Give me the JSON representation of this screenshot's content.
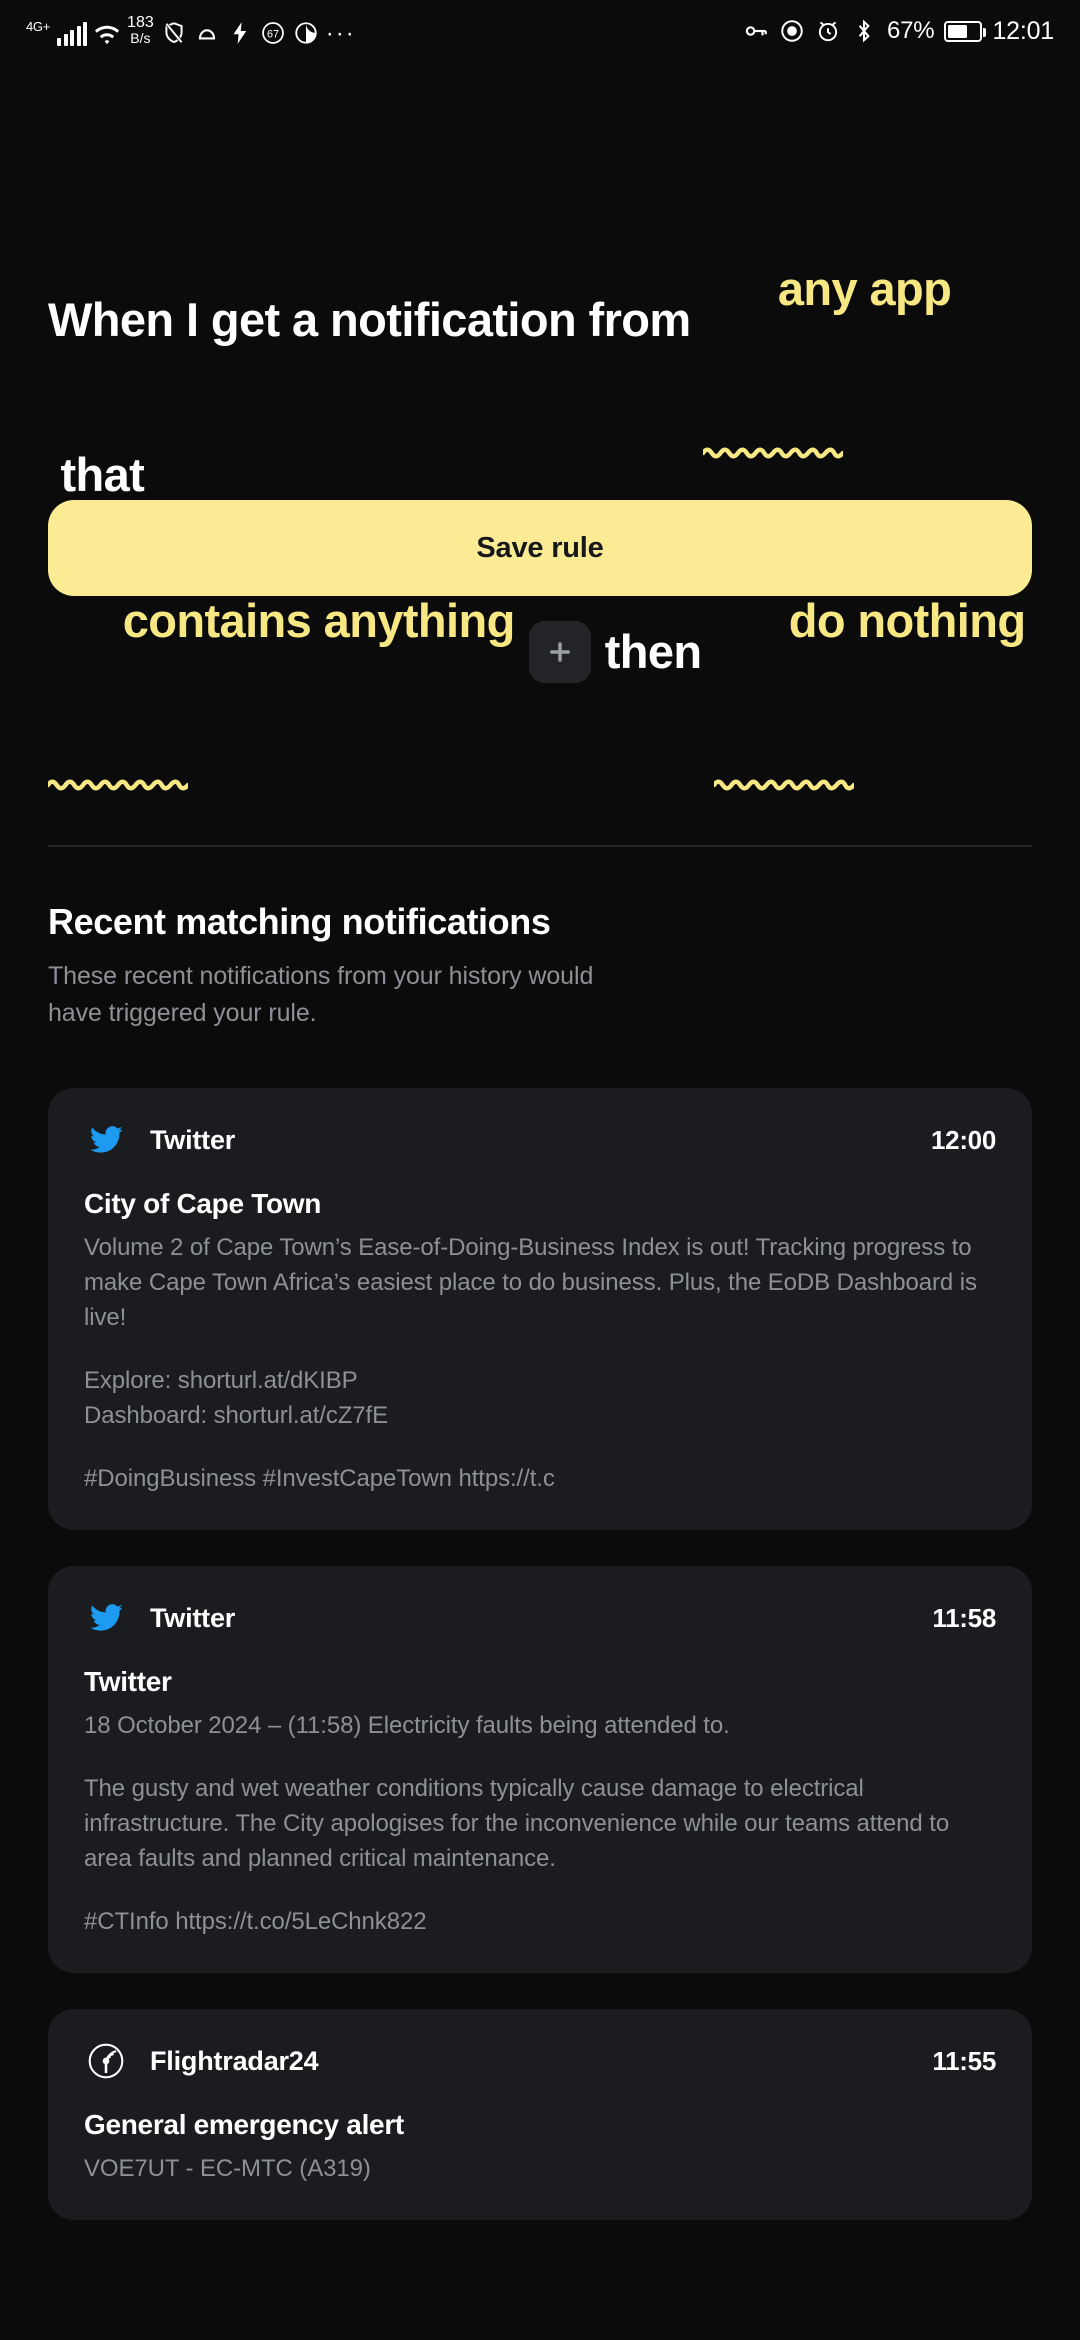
{
  "status_bar": {
    "network_type": "4G+",
    "data_rate_value": "183",
    "data_rate_unit": "B/s",
    "icons_left": [
      "signal-bars-icon",
      "wifi-icon",
      "shield-slash-icon",
      "cloud-icon",
      "bolt-icon",
      "do-not-disturb-67-icon",
      "moon-icon",
      "overflow-dots-icon"
    ],
    "overflow": "···",
    "icons_right": [
      "vpn-key-icon",
      "eye-icon",
      "alarm-icon",
      "bluetooth-icon"
    ],
    "battery_percent": "67%",
    "clock": "12:01"
  },
  "rule": {
    "line1": {
      "prefix": "When I get a notification from ",
      "slot_app": "any app",
      "suffix": " that"
    },
    "line2": {
      "slot_condition": "contains anything",
      "add_label": "+",
      "then": "then ",
      "slot_action": "do nothing"
    }
  },
  "save_button": {
    "label": "Save rule"
  },
  "recent": {
    "title": "Recent matching notifications",
    "subtitle": "These recent notifications from your history would have triggered your rule."
  },
  "notifications": [
    {
      "app": "Twitter",
      "icon": "twitter-bird-icon",
      "icon_color": "#1d9bf0",
      "time": "12:00",
      "title": "City of Cape Town",
      "paragraphs": [
        "Volume 2 of Cape Town’s Ease-of-Doing-Business Index is out! Tracking progress to make Cape Town Africa’s easiest place to do business. Plus, the EoDB Dashboard is live!",
        "Explore: shorturl.at/dKIBP\nDashboard: shorturl.at/cZ7fE",
        "#DoingBusiness #InvestCapeTown https://t.c"
      ]
    },
    {
      "app": "Twitter",
      "icon": "twitter-bird-icon",
      "icon_color": "#1d9bf0",
      "time": "11:58",
      "title": "Twitter",
      "paragraphs": [
        "18 October 2024 – (11:58) Electricity faults being attended to.",
        "The gusty and wet weather conditions typically cause damage to electrical infrastructure. The City apologises for the inconvenience while our teams attend to area faults and planned critical maintenance.",
        "#CTInfo https://t.co/5LeChnk822"
      ]
    },
    {
      "app": "Flightradar24",
      "icon": "flightradar-radar-icon",
      "icon_color": "#ffffff",
      "time": "11:55",
      "title": "General emergency alert",
      "paragraphs": [
        "VOE7UT - EC-MTC (A319)"
      ]
    }
  ],
  "colors": {
    "background": "#0b0b0c",
    "accent_yellow": "#f7e884",
    "button_yellow": "#fbeb95",
    "card_background": "#1b1c20",
    "muted_text": "#8d9095"
  }
}
